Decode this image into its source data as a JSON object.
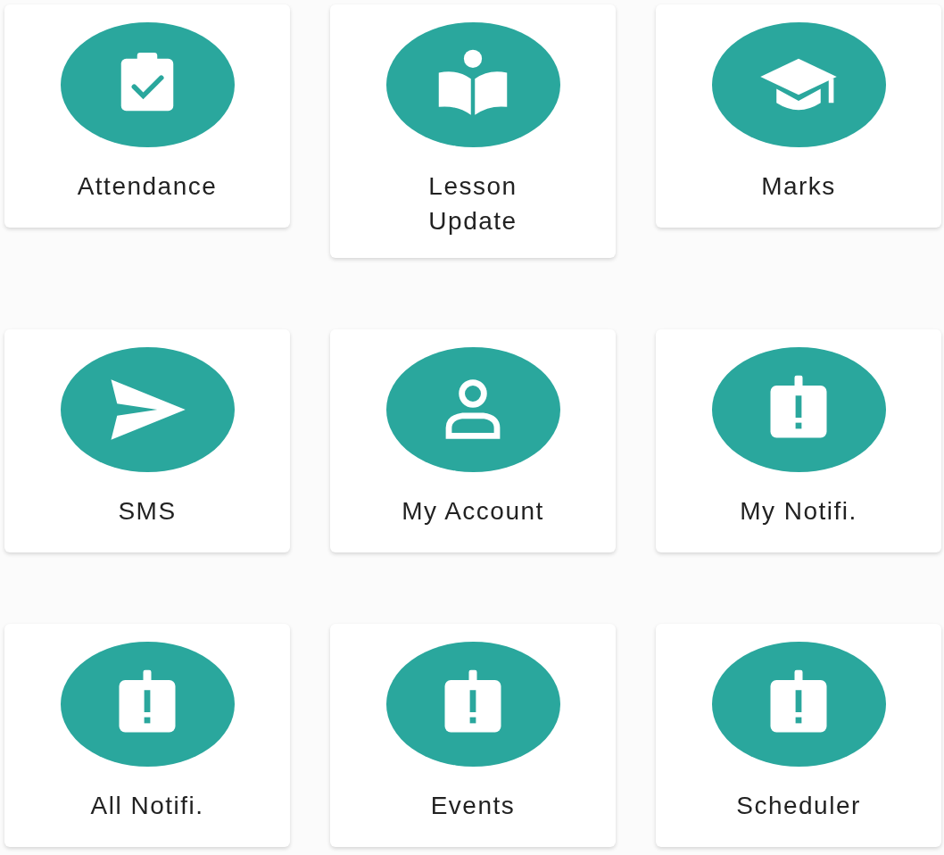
{
  "tiles": [
    {
      "label": "Attendance",
      "kind": "clipboard-check"
    },
    {
      "label": "Lesson Update",
      "kind": "book-reader"
    },
    {
      "label": "Marks",
      "kind": "graduation-cap"
    },
    {
      "label": "SMS",
      "kind": "send"
    },
    {
      "label": "My Account",
      "kind": "person"
    },
    {
      "label": "My Notifi.",
      "kind": "clipboard-alert"
    },
    {
      "label": "All Notifi.",
      "kind": "clipboard-alert"
    },
    {
      "label": "Events",
      "kind": "clipboard-alert"
    },
    {
      "label": "Scheduler",
      "kind": "clipboard-alert"
    }
  ]
}
